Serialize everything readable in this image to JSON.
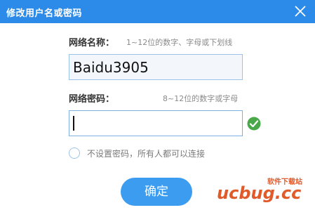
{
  "titlebar": {
    "title": "修改用户名或密码",
    "close_icon": "close-icon"
  },
  "ssid": {
    "label": "网络名称：",
    "hint": "1~12位的数字、字母或下划线",
    "value": "Baidu3905"
  },
  "password": {
    "label": "网络密码：",
    "hint": "8~12位的数字或字母",
    "value": "",
    "status_icon": "check-circle-icon",
    "status_color": "#4aa84a"
  },
  "no_password": {
    "checked": false,
    "label": "不设置密码，所有人都可以连接"
  },
  "confirm_label": "确定",
  "watermark": {
    "logo": "ucbug.cc",
    "small": "软件下载站"
  },
  "colors": {
    "titlebar": "#2c8be9",
    "button": "#3b9cf0"
  }
}
